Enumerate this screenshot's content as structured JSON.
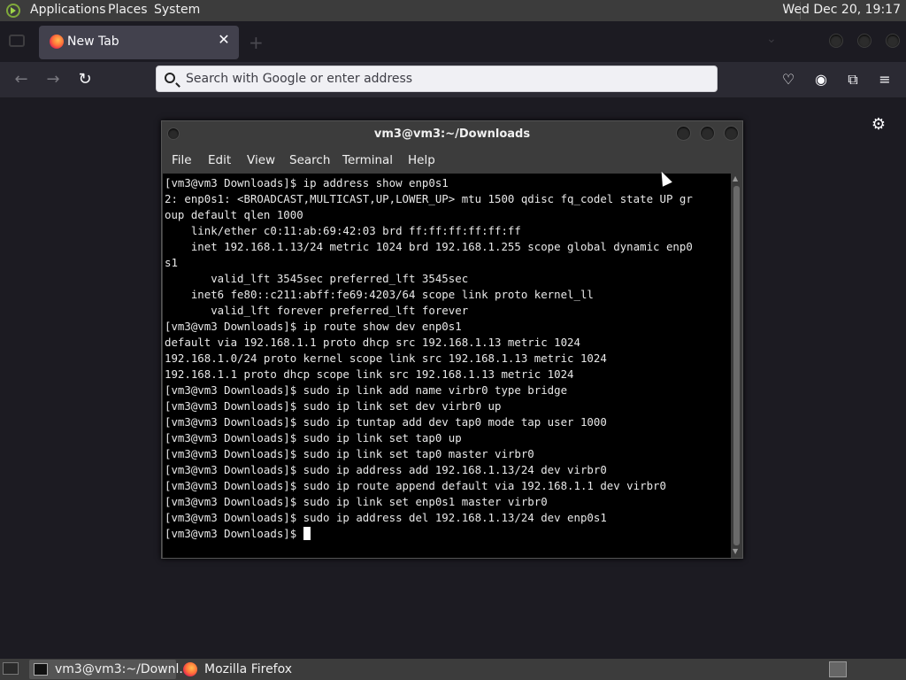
{
  "top_panel": {
    "menus": [
      "Applications",
      "Places",
      "System"
    ],
    "clock": "Wed Dec 20, 19:17"
  },
  "browser": {
    "tab_title": "New Tab",
    "url_placeholder": "Search with Google or enter address"
  },
  "terminal": {
    "title": "vm3@vm3:~/Downloads",
    "menus": [
      "File",
      "Edit",
      "View",
      "Search",
      "Terminal",
      "Help"
    ],
    "lines": [
      "[vm3@vm3 Downloads]$ ip address show enp0s1",
      "2: enp0s1: <BROADCAST,MULTICAST,UP,LOWER_UP> mtu 1500 qdisc fq_codel state UP gr",
      "oup default qlen 1000",
      "    link/ether c0:11:ab:69:42:03 brd ff:ff:ff:ff:ff:ff",
      "    inet 192.168.1.13/24 metric 1024 brd 192.168.1.255 scope global dynamic enp0",
      "s1",
      "       valid_lft 3545sec preferred_lft 3545sec",
      "    inet6 fe80::c211:abff:fe69:4203/64 scope link proto kernel_ll",
      "       valid_lft forever preferred_lft forever",
      "[vm3@vm3 Downloads]$ ip route show dev enp0s1",
      "default via 192.168.1.1 proto dhcp src 192.168.1.13 metric 1024",
      "192.168.1.0/24 proto kernel scope link src 192.168.1.13 metric 1024",
      "192.168.1.1 proto dhcp scope link src 192.168.1.13 metric 1024",
      "[vm3@vm3 Downloads]$ sudo ip link add name virbr0 type bridge",
      "[vm3@vm3 Downloads]$ sudo ip link set dev virbr0 up",
      "[vm3@vm3 Downloads]$ sudo ip tuntap add dev tap0 mode tap user 1000",
      "[vm3@vm3 Downloads]$ sudo ip link set tap0 up",
      "[vm3@vm3 Downloads]$ sudo ip link set tap0 master virbr0",
      "[vm3@vm3 Downloads]$ sudo ip address add 192.168.1.13/24 dev virbr0",
      "[vm3@vm3 Downloads]$ sudo ip route append default via 192.168.1.1 dev virbr0",
      "[vm3@vm3 Downloads]$ sudo ip link set enp0s1 master virbr0",
      "[vm3@vm3 Downloads]$ sudo ip address del 192.168.1.13/24 dev enp0s1"
    ],
    "prompt": "[vm3@vm3 Downloads]$ "
  },
  "taskbar": {
    "items": [
      {
        "label": "vm3@vm3:~/Downl...",
        "icon": "terminal-icon"
      },
      {
        "label": "Mozilla Firefox",
        "icon": "firefox-icon"
      }
    ]
  },
  "colors": {
    "panel": "#3c3c3c",
    "browser_bg": "#1c1b22",
    "terminal_bg": "#000000",
    "terminal_fg": "#e8e8e8"
  }
}
